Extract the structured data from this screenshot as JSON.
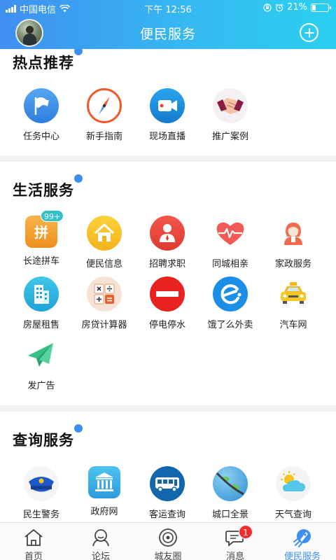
{
  "status_bar": {
    "carrier": "中国电信",
    "time": "下午 12:56",
    "battery": "21%",
    "battery_level": 0.21
  },
  "header": {
    "title": "便民服务"
  },
  "sections": {
    "hot": {
      "title": "热点推荐",
      "items": [
        {
          "label": "任务中心",
          "icon": "task-flag-icon"
        },
        {
          "label": "新手指南",
          "icon": "compass-icon"
        },
        {
          "label": "现场直播",
          "icon": "video-camera-icon"
        },
        {
          "label": "推广案例",
          "icon": "handshake-icon"
        }
      ]
    },
    "life": {
      "title": "生活服务",
      "items": [
        {
          "label": "长途拼车",
          "icon": "carpool-icon",
          "badge": "99+"
        },
        {
          "label": "便民信息",
          "icon": "house-icon"
        },
        {
          "label": "招聘求职",
          "icon": "recruit-person-icon"
        },
        {
          "label": "同城相亲",
          "icon": "heart-pulse-icon"
        },
        {
          "label": "家政服务",
          "icon": "housekeeper-icon"
        },
        {
          "label": "房屋租售",
          "icon": "building-icon"
        },
        {
          "label": "房贷计算器",
          "icon": "calculator-icon"
        },
        {
          "label": "停电停水",
          "icon": "no-entry-icon"
        },
        {
          "label": "饿了么外卖",
          "icon": "eleme-icon"
        },
        {
          "label": "汽车网",
          "icon": "taxi-icon"
        },
        {
          "label": "发广告",
          "icon": "paper-plane-icon"
        }
      ]
    },
    "query": {
      "title": "查询服务",
      "items": [
        {
          "label": "民生警务",
          "icon": "police-cap-icon"
        },
        {
          "label": "政府网",
          "icon": "government-building-icon"
        },
        {
          "label": "客运查询",
          "icon": "bus-icon"
        },
        {
          "label": "城口全景",
          "icon": "panorama-globe-icon"
        },
        {
          "label": "天气查询",
          "icon": "weather-sun-cloud-icon"
        }
      ]
    }
  },
  "tabbar": {
    "tabs": [
      {
        "label": "首页",
        "icon": "home-icon"
      },
      {
        "label": "论坛",
        "icon": "forum-icon"
      },
      {
        "label": "城友圈",
        "icon": "circle-icon"
      },
      {
        "label": "消息",
        "icon": "message-icon",
        "badge": "1"
      },
      {
        "label": "便民服务",
        "icon": "rocket-icon",
        "active": true
      }
    ]
  },
  "colors": {
    "header_start": "#3f8ff0",
    "header_end": "#2ad0ef",
    "accent": "#3d8ff2",
    "badge_red": "#f02d2d"
  }
}
